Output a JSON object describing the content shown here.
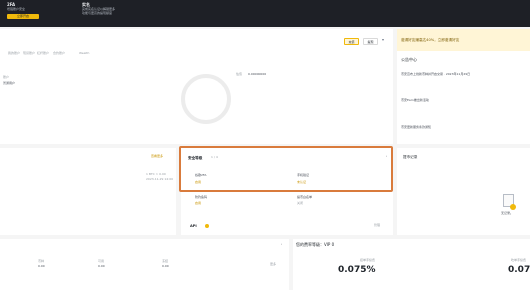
{
  "topbar": {
    "feature1_title": "2FA",
    "feature1_desc": "增强账户安全",
    "feature1_button": "立即开启",
    "feature2_title": "实名",
    "feature2_desc_line1": "完成实名认证以解锁更多",
    "feature2_desc_line2": "功能与更高的提现额度"
  },
  "main": {
    "tabs": [
      "我的账户",
      "现货账户",
      "杠杆账户",
      "合约账户",
      "Wealth"
    ],
    "action_primary": "充值",
    "action_secondary": "提现",
    "user_line1": "账户",
    "user_line2": "普通用户",
    "balance_label": "估值",
    "balance_value": "0.00000000"
  },
  "notice": {
    "banner": "邀请好友赚高达40%，立即邀请好友",
    "section_title": "公告中心",
    "items": [
      "币安宣布上线新币种并开启交易 · 2023年11月29日",
      "币安Earn推出新活动",
      "币安更新服务条款通知"
    ]
  },
  "left_mid": {
    "link": "查看更多",
    "row1_a": "1 BTC ≈ 0.00",
    "row1_b": "2023-11-29 14:00"
  },
  "security": {
    "title": "安全等级",
    "level": "1 / 4",
    "items": [
      {
        "label": "谷歌2FA",
        "action": "启用"
      },
      {
        "label": "手机验证",
        "action": "未认证"
      },
      {
        "label": "防钓鱼码",
        "action": "启用"
      },
      {
        "label": "提币白名单",
        "action": "关闭"
      }
    ]
  },
  "api": {
    "label": "API",
    "action": "管理"
  },
  "records": {
    "title": "提币记录",
    "empty_text": "无记录。"
  },
  "bottom_left": {
    "col_headers": [
      "币种",
      "可用",
      "冻结",
      "估值"
    ],
    "row_values": [
      "0.00",
      "0.00",
      "0.00",
      "--"
    ],
    "more": "更多"
  },
  "fees": {
    "title": "您的费率等级：VIP 0",
    "maker_label": "挂单手续费",
    "maker_rate": "0.075%",
    "taker_label": "吃单手续费",
    "taker_rate": "0.075%"
  },
  "colors": {
    "accent": "#f0b90b",
    "highlight": "#d97b3c"
  }
}
